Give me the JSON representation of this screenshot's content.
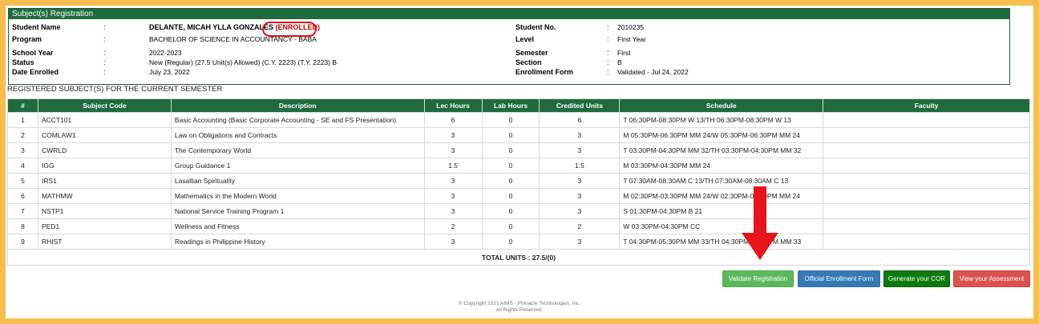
{
  "panel": {
    "title": "Subject(s) Registration"
  },
  "student": {
    "name_label": "Student Name",
    "name": "DELANTE, MICAH YLLA GONZALES",
    "enrolled": "(ENROLLED)",
    "program_label": "Program",
    "program": "BACHELOR OF SCIENCE IN ACCOUNTANCY - BABA",
    "school_year_label": "School Year",
    "school_year": "2022-2023",
    "status_label": "Status",
    "status": "New (Regular) (27.5 Unit(s) Allowed) (C.Y. 2223) (T.Y. 2223) B",
    "date_enrolled_label": "Date Enrolled",
    "date_enrolled": "July 23, 2022",
    "student_no_label": "Student No.",
    "student_no": "2010235",
    "level_label": "Level",
    "level": "First Year",
    "semester_label": "Semester",
    "semester": "First",
    "section_label": "Section",
    "section": "B",
    "enrollment_form_label": "Enrollment Form",
    "enrollment_form": "Validated - Jul 24, 2022",
    "colon": ":"
  },
  "section_title": "REGISTERED SUBJECT(S) FOR THE CURRENT SEMESTER",
  "table": {
    "headers": [
      "#",
      "Subject Code",
      "Description",
      "Lec Hours",
      "Lab Hours",
      "Credited Units",
      "Schedule",
      "Faculty"
    ],
    "rows": [
      [
        "1",
        "ACCT101",
        "Basic Accounting (Basic Corporate Accounting - SE and FS Presentation)",
        "6",
        "0",
        "6",
        "T 06:30PM-08:30PM W 13/TH 06:30PM-08:30PM W 13",
        ""
      ],
      [
        "2",
        "COMLAW1",
        "Law on Obligations and Contracts",
        "3",
        "0",
        "3",
        "M 05:30PM-06:30PM MM 24/W 05:30PM-06:30PM MM 24",
        ""
      ],
      [
        "3",
        "CWRLD",
        "The Contemporary World",
        "3",
        "0",
        "3",
        "T 03:30PM-04:30PM MM 32/TH 03:30PM-04:30PM MM 32",
        ""
      ],
      [
        "4",
        "IGG",
        "Group Guidance 1",
        "1.5",
        "0",
        "1.5",
        "M 03:30PM-04:30PM MM 24",
        ""
      ],
      [
        "5",
        "IRS1",
        "Lasallian Spirituality",
        "3",
        "0",
        "3",
        "T 07:30AM-08:30AM C 13/TH 07:30AM-08:30AM C 13",
        ""
      ],
      [
        "6",
        "MATHMW",
        "Mathematics in the Modern World",
        "3",
        "0",
        "3",
        "M 02:30PM-03:30PM MM 24/W 02:30PM-03:30PM MM 24",
        ""
      ],
      [
        "7",
        "NSTP1",
        "National Service Training Program 1",
        "3",
        "0",
        "3",
        "S 01:30PM-04:30PM B 21",
        ""
      ],
      [
        "8",
        "PED1",
        "Wellness and Fitness",
        "2",
        "0",
        "2",
        "W 03:30PM-04:30PM CC",
        ""
      ],
      [
        "9",
        "RHIST",
        "Readings in Philippine History",
        "3",
        "0",
        "3",
        "T 04:30PM-05:30PM MM 33/TH 04:30PM-05:30PM MM 33",
        ""
      ]
    ],
    "total": "TOTAL UNITS : 27.5/(0)"
  },
  "buttons": {
    "validate": "Validate Registration",
    "official_form": "Official Enrollment Form",
    "generate_cor": "Generate your COR",
    "view_assessment": "View your Assessment"
  },
  "footer": {
    "line1": "© Copyright 2021 AIMS - Pinnacle Technologies, Inc.",
    "line2": "All Rights Reserved."
  },
  "colors": {
    "header_green": "#1f6b3e",
    "frame": "#f6bd4f",
    "validate": "#5cb85c",
    "official": "#337ab7",
    "cor": "#0e7a0e",
    "assessment": "#d9534f",
    "arrow": "#e8141b"
  }
}
